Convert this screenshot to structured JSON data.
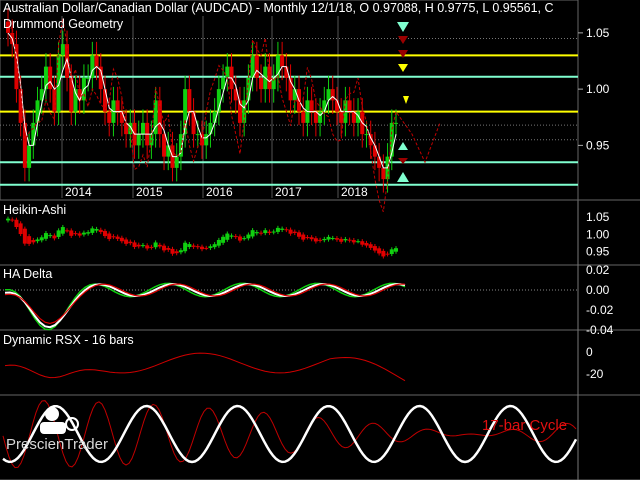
{
  "header": {
    "title": "Australian Dollar/Canadian Dollar (AUDCAD) - Monthly 12/1/18, O 0.97088, H 0.9775, L 0.95561, C",
    "overlay_label": "Drummond Geometry"
  },
  "panels": {
    "heikin_ashi": "Heikin-Ashi",
    "ha_delta": "HA Delta",
    "dynamic_rsx": "Dynamic RSX - 16 bars"
  },
  "branding": {
    "logo_text": "PrescienTrader",
    "cycle_label": "17-bar Cycle"
  },
  "colors": {
    "up": "#10d010",
    "down": "#e00000",
    "yellow": "#ffff00",
    "cyan": "#80ffd0",
    "white": "#ffffff",
    "red_line": "#c00000"
  },
  "chart_data": [
    {
      "type": "candlestick",
      "title": "Australian Dollar/Canadian Dollar (AUDCAD) - Monthly 12/1/18, O 0.97088, H 0.9775, L 0.95561, C",
      "x_tick_labels": [
        "2014",
        "2015",
        "2016",
        "2017",
        "2018"
      ],
      "y_tick_labels": [
        "1.05",
        "1.00",
        "0.95"
      ],
      "ylim": [
        0.905,
        1.065
      ],
      "horizontal_levels": {
        "yellow": [
          1.03,
          0.98
        ],
        "cyan": [
          1.011,
          0.935,
          0.915
        ]
      },
      "last_bar": {
        "date": "12/1/18",
        "open": 0.97088,
        "high": 0.9775,
        "low": 0.95561
      },
      "close_series": [
        1.05,
        1.04,
        1.0,
        0.97,
        0.93,
        0.95,
        0.97,
        0.99,
        1.0,
        1.02,
        1.0,
        0.98,
        1.03,
        1.04,
        1.01,
        0.98,
        1.0,
        0.99,
        1.01,
        1.01,
        1.03,
        1.02,
        1.0,
        0.98,
        0.97,
        0.99,
        0.98,
        0.97,
        0.96,
        0.97,
        0.95,
        0.96,
        0.97,
        0.95,
        0.96,
        0.99,
        0.96,
        0.94,
        0.95,
        0.93,
        0.94,
        0.96,
        1.0,
        0.98,
        0.96,
        0.96,
        0.95,
        0.96,
        0.97,
        0.98,
        1.0,
        1.01,
        1.02,
        1.0,
        0.99,
        0.97,
        0.99,
        1.01,
        1.03,
        1.01,
        1.0,
        1.02,
        1.0,
        1.01,
        1.03,
        1.02,
        1.01,
        0.99,
        1.0,
        0.98,
        0.97,
        0.99,
        0.98,
        0.97,
        0.98,
        0.99,
        1.0,
        0.99,
        0.98,
        0.97,
        0.99,
        0.98,
        0.97,
        0.98,
        0.96,
        0.96,
        0.95,
        0.94,
        0.93,
        0.92,
        0.94,
        0.97,
        0.97
      ]
    },
    {
      "type": "candlestick",
      "title": "Heikin-Ashi",
      "y_tick_labels": [
        "1.05",
        "1.00",
        "0.95"
      ]
    },
    {
      "type": "line",
      "title": "HA Delta",
      "y_tick_labels": [
        "0.02",
        "0.00",
        "-0.02",
        "-0.04"
      ]
    },
    {
      "type": "line",
      "title": "Dynamic RSX - 16 bars",
      "y_tick_labels": [
        "0",
        "-20"
      ]
    },
    {
      "type": "line",
      "title": "17-bar Cycle"
    }
  ]
}
